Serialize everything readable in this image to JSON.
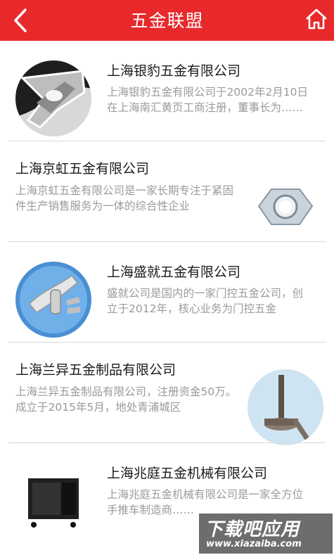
{
  "header": {
    "title": "五金联盟",
    "back_icon": "chevron-left-icon",
    "home_icon": "home-icon",
    "color": "#e8292b"
  },
  "companies": [
    {
      "name": "上海银豹五金有限公司",
      "desc": "上海银豹五金有限公司于2002年2月10日在上海南汇黄页工商注册，董事长为……",
      "image": "chrome-latch-photo"
    },
    {
      "name": "上海京虹五金有限公司",
      "desc": "上海京虹五金有限公司是一家长期专注于紧固件生产销售服务为一体的综合性企业",
      "image": "hex-nut-photo"
    },
    {
      "name": "上海盛就五金有限公司",
      "desc": "盛就公司是国内的一家门控五金公司，创立于2012年，核心业务为门控五金",
      "image": "door-lock-handle-photo"
    },
    {
      "name": "上海兰异五金制品有限公司",
      "desc": "上海兰异五金制品有限公司，注册资金50万。成立于2015年5月，地处青浦城区",
      "image": "gear-shaft-photo"
    },
    {
      "name": "上海兆庭五金机械有限公司",
      "desc": "上海兆庭五金机械有限公司是一家全方位手推车制造商……",
      "image": "cart-cabinet-photo"
    }
  ],
  "watermark": {
    "line1": "下载吧应用",
    "line2": "www.xiazaiba.com"
  }
}
